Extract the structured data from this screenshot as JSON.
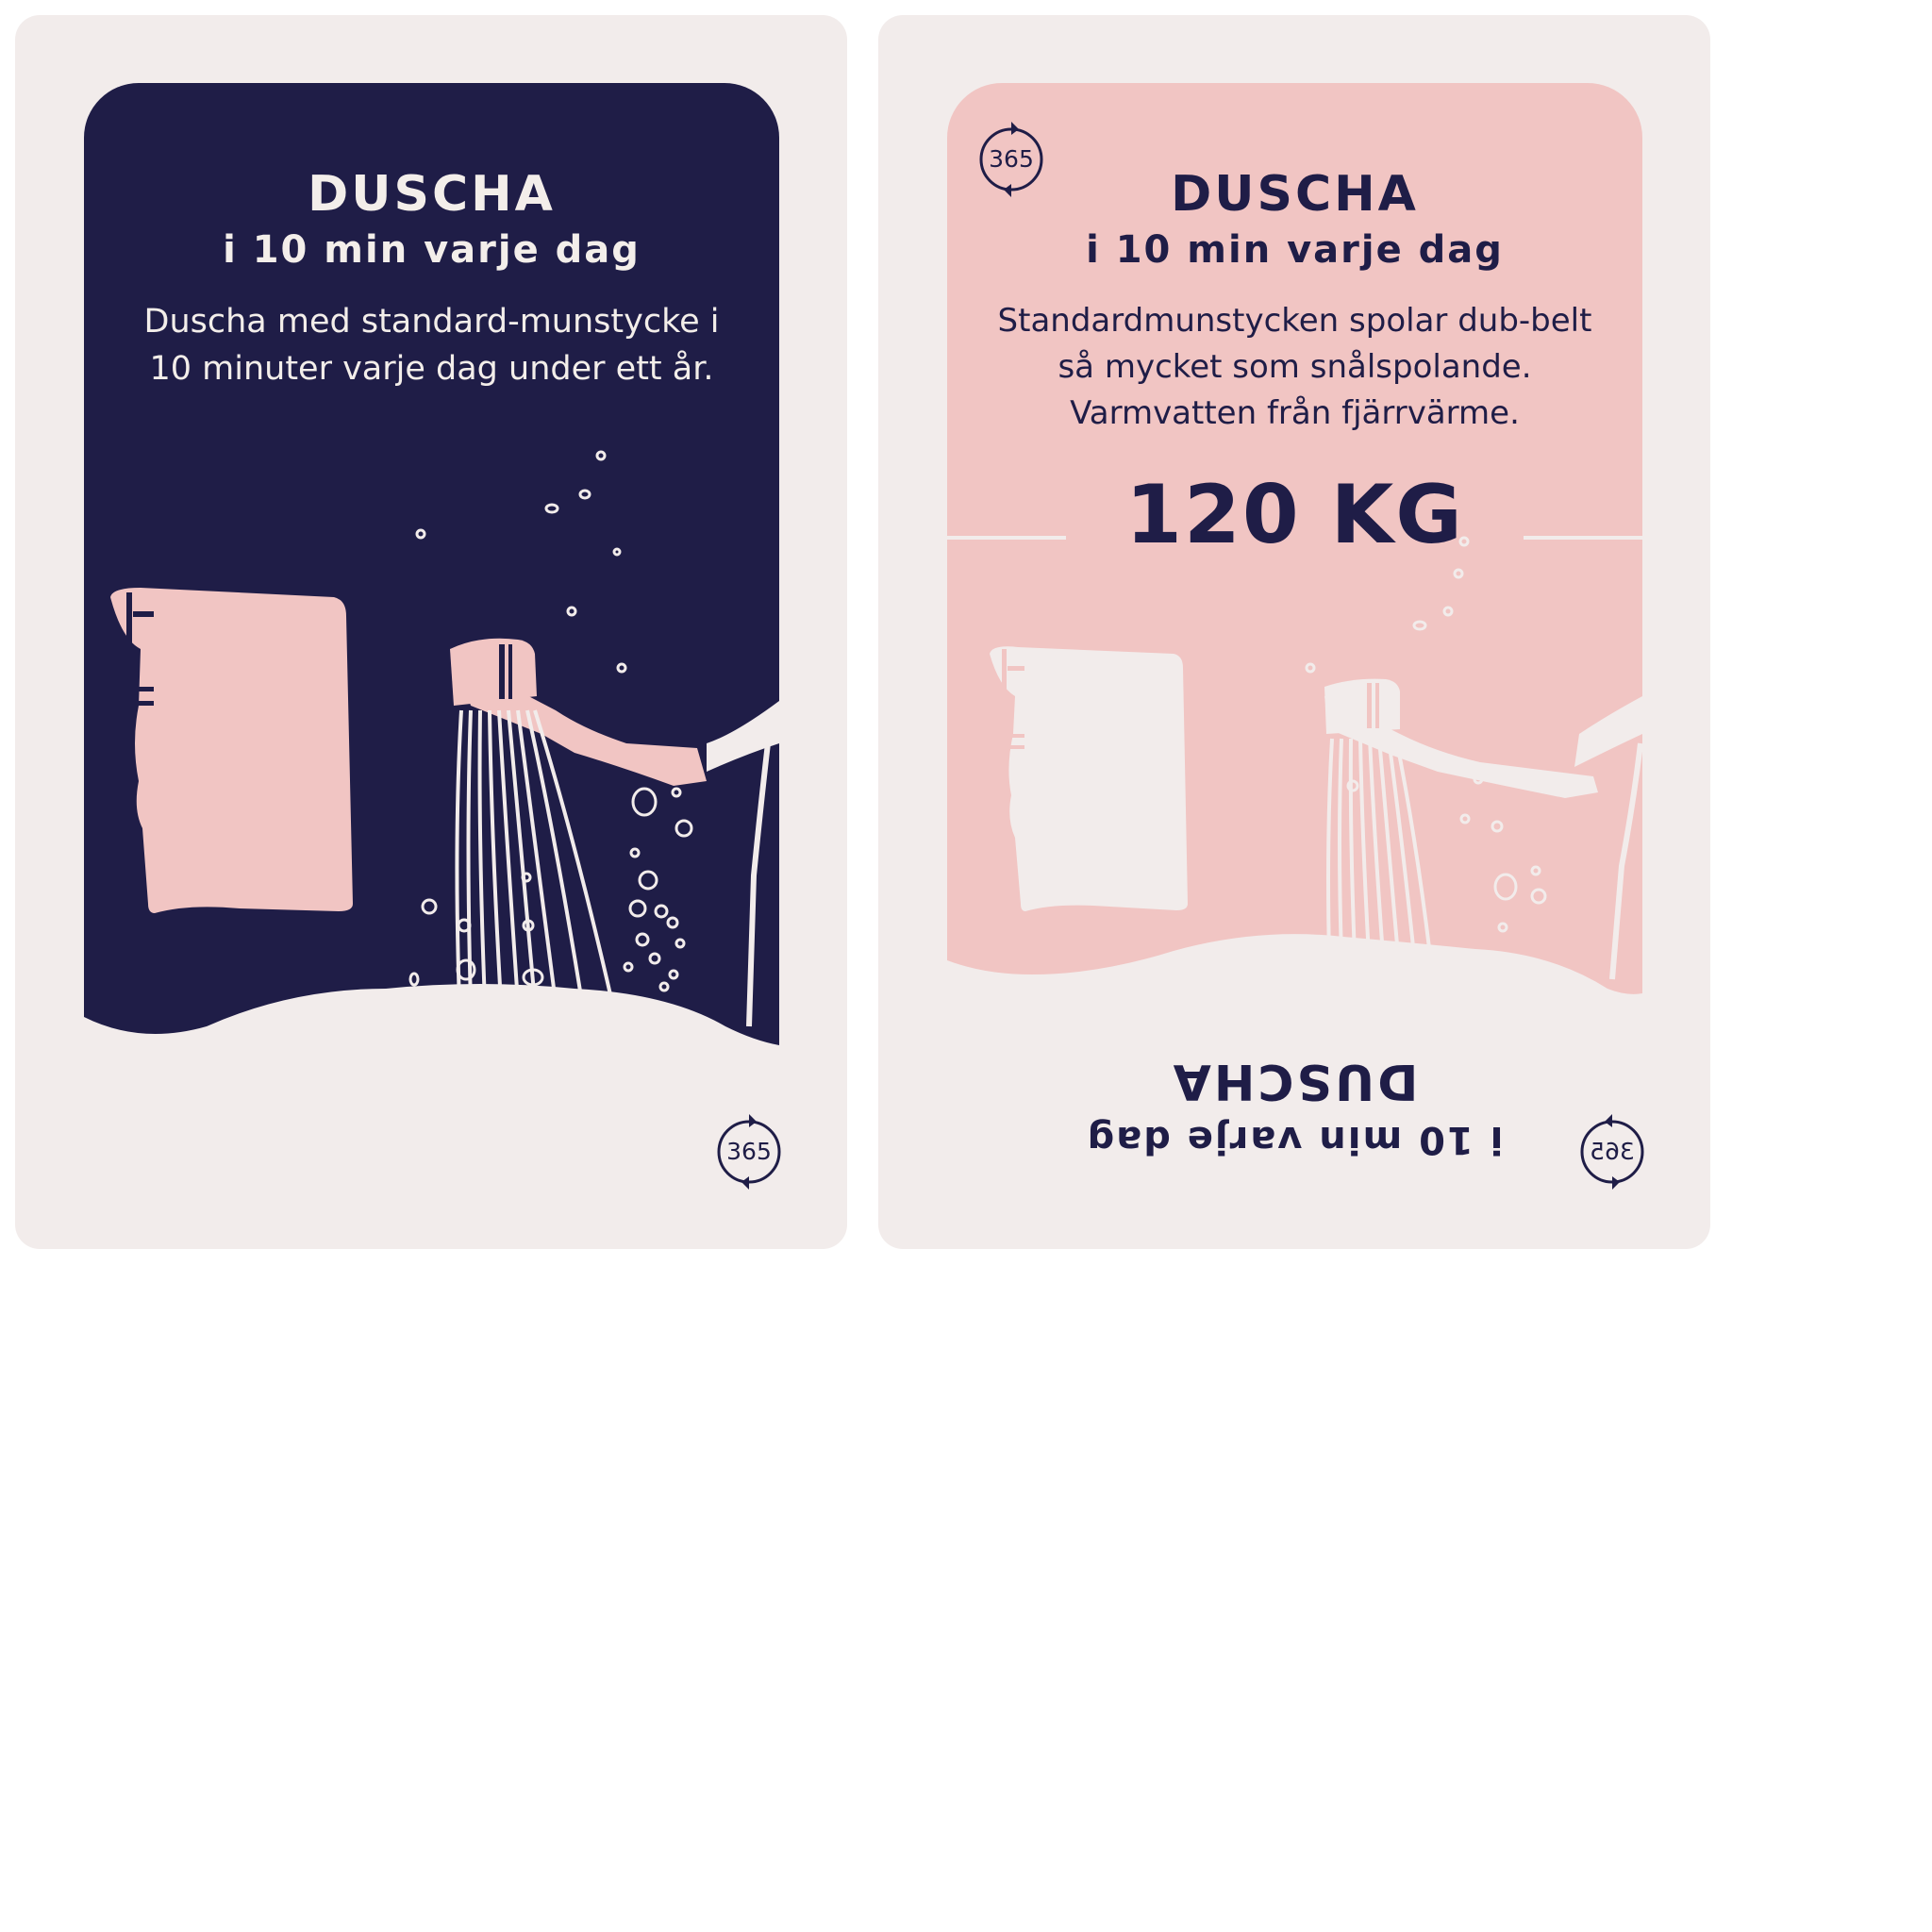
{
  "cards": {
    "front": {
      "title": "DUSCHA",
      "subtitle": "i 10 min varje dag",
      "description": "Duscha med standard-munstycke i 10 minuter varje dag under ett år.",
      "badge": "365",
      "icons": [
        "towel-icon",
        "shower-head-icon",
        "water-bubbles-icon",
        "repeat-cycle-icon"
      ]
    },
    "back": {
      "title": "DUSCHA",
      "subtitle": "i 10 min varje dag",
      "description": "Standardmunstycken spolar dub-belt så mycket som snålspolande. Varmvatten från fjärrvärme.",
      "value": "120 KG",
      "badge": "365",
      "flipped_title": "DUSCHA",
      "flipped_subtitle": "i 10 min varje dag"
    }
  },
  "colors": {
    "navy": "#1f1d47",
    "pink": "#f1c5c3",
    "cream": "#f2eceb"
  }
}
